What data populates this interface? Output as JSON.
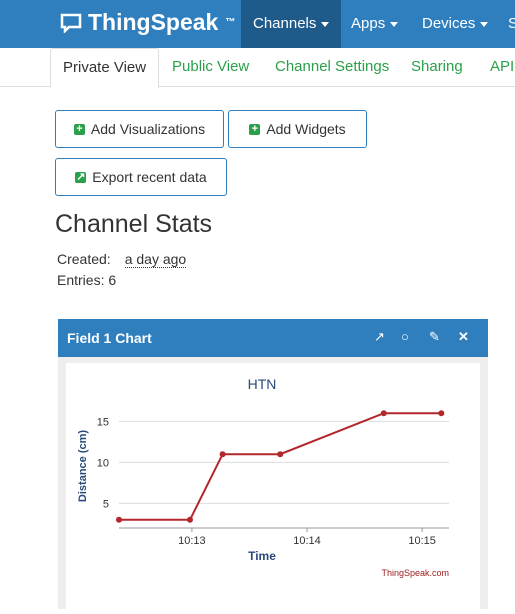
{
  "nav": {
    "brand": "ThingSpeak",
    "tm": "™",
    "items": [
      "Channels",
      "Apps",
      "Devices",
      "S"
    ]
  },
  "tabs": [
    "Private View",
    "Public View",
    "Channel Settings",
    "Sharing",
    "API"
  ],
  "buttons": {
    "add_visualizations": "Add Visualizations",
    "add_widgets": "Add Widgets",
    "export": "Export recent data"
  },
  "stats": {
    "title": "Channel Stats",
    "created_label": "Created:",
    "created_value": "a day ago",
    "entries_label": "Entries: 6"
  },
  "panel": {
    "title": "Field 1 Chart",
    "icons": [
      "external-link-icon",
      "comment-icon",
      "pencil-icon",
      "close-icon"
    ]
  },
  "colors": {
    "nav": "#2f7fbf",
    "tab": "#2aa04a",
    "series": "#b3262b"
  },
  "chart_data": {
    "type": "line",
    "title": "HTN",
    "xlabel": "Time",
    "ylabel": "Distance (cm)",
    "credit": "ThingSpeak.com",
    "x_ticks": [
      "10:13",
      "10:14",
      "10:15"
    ],
    "y_ticks": [
      5,
      10,
      15
    ],
    "xlim": [
      "10:12:22",
      "10:15:14"
    ],
    "ylim": [
      2,
      17
    ],
    "series": [
      {
        "x": [
          "10:12:22",
          "10:12:59",
          "10:13:16",
          "10:13:46",
          "10:14:40",
          "10:15:10"
        ],
        "values": [
          3,
          3,
          11,
          11,
          16,
          16
        ]
      }
    ]
  }
}
